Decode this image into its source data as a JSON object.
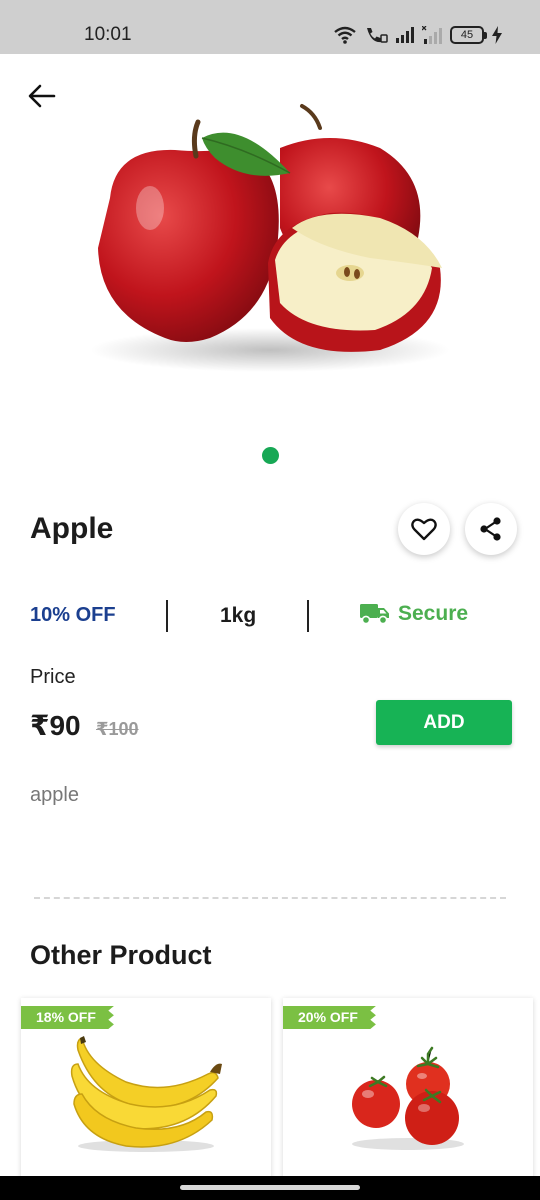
{
  "status": {
    "time": "10:01",
    "battery": "45",
    "icons": [
      "wifi-icon",
      "wifi-call-icon",
      "signal-icon",
      "signal-weak-icon",
      "battery-icon",
      "charging-icon"
    ]
  },
  "product": {
    "name": "Apple",
    "image_icon": "apple-image",
    "discount": "10% OFF",
    "weight": "1kg",
    "secure": "Secure",
    "price_label": "Price",
    "price": "₹90",
    "old_price": "₹100",
    "add_label": "ADD",
    "description": "apple"
  },
  "carousel": {
    "total": 1,
    "active": 0
  },
  "other": {
    "title": "Other Product",
    "items": [
      {
        "badge": "18% OFF",
        "image_icon": "banana-image"
      },
      {
        "badge": "20% OFF",
        "image_icon": "tomato-image"
      }
    ]
  },
  "colors": {
    "accent": "#17b355",
    "discount": "#1b3f8f",
    "secure": "#4caf50",
    "badge": "#7bc043"
  }
}
